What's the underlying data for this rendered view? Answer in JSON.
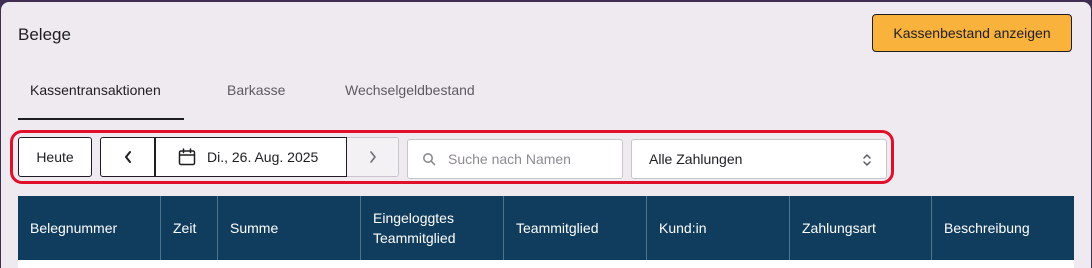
{
  "header": {
    "title": "Belege",
    "primary_button": "Kassenbestand anzeigen"
  },
  "tabs": [
    {
      "label": "Kassentransaktionen",
      "active": true
    },
    {
      "label": "Barkasse",
      "active": false
    },
    {
      "label": "Wechselgeldbestand",
      "active": false
    }
  ],
  "toolbar": {
    "today_label": "Heute",
    "date_label": "Di., 26. Aug. 2025",
    "search_placeholder": "Suche nach Namen",
    "search_value": "",
    "payment_filter": "Alle Zahlungen"
  },
  "table": {
    "columns": [
      "Belegnummer",
      "Zeit",
      "Summe",
      "Eingeloggtes Teammitglied",
      "Teammitglied",
      "Kund:in",
      "Zahlungsart",
      "Beschreibung"
    ]
  },
  "icons": {
    "prev": "chevron-left-icon",
    "next": "chevron-right-icon",
    "calendar": "calendar-icon",
    "search": "search-icon",
    "select": "chevron-up-down-icon"
  },
  "colors": {
    "accent": "#f9b33d",
    "table_header": "#103d5d",
    "highlight": "#e0102a"
  }
}
